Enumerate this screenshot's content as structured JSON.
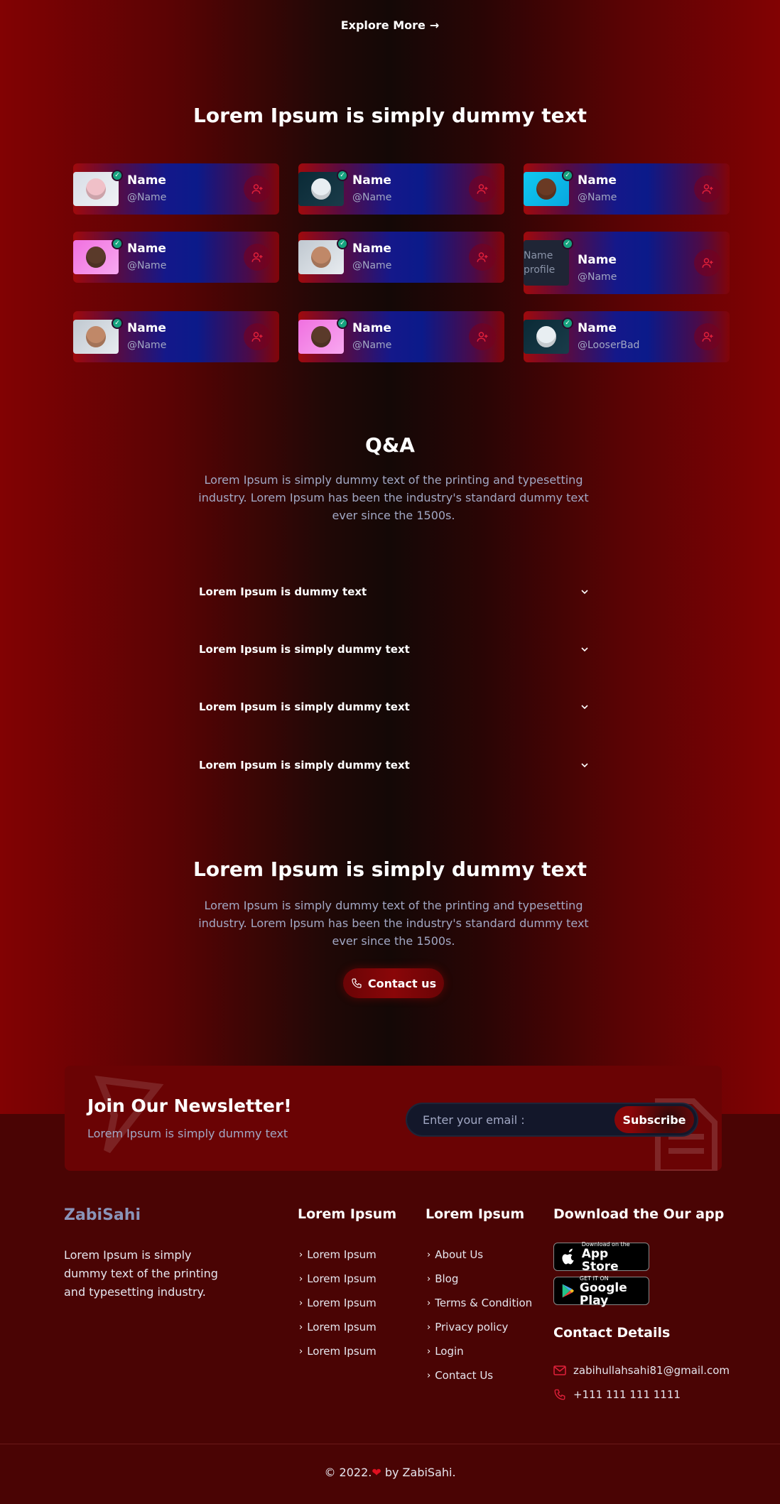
{
  "explore": {
    "label": "Explore More"
  },
  "creators": {
    "title": "Lorem Ipsum is simply dummy text",
    "cards": [
      {
        "name": "Name",
        "handle": "@Name"
      },
      {
        "name": "Name",
        "handle": "@Name"
      },
      {
        "name": "Name",
        "handle": "@Name"
      },
      {
        "name": "Name",
        "handle": "@Name"
      },
      {
        "name": "Name",
        "handle": "@Name"
      },
      {
        "name": "Name",
        "handle": "@Name",
        "broken_image_alt": "Name profile"
      },
      {
        "name": "Name",
        "handle": "@Name"
      },
      {
        "name": "Name",
        "handle": "@Name"
      },
      {
        "name": "Name",
        "handle": "@LooserBad"
      }
    ]
  },
  "qa": {
    "title": "Q&A",
    "description": "Lorem Ipsum is simply dummy text of the printing and typesetting industry. Lorem Ipsum has been the industry's standard dummy text ever since the 1500s.",
    "items": [
      {
        "question": "Lorem Ipsum is dummy text"
      },
      {
        "question": "Lorem Ipsum is simply dummy text"
      },
      {
        "question": "Lorem Ipsum is simply dummy text"
      },
      {
        "question": "Lorem Ipsum is simply dummy text"
      }
    ]
  },
  "cta": {
    "title": "Lorem Ipsum is simply dummy text",
    "description": "Lorem Ipsum is simply dummy text of the printing and typesetting industry. Lorem Ipsum has been the industry's standard dummy text ever since the 1500s.",
    "button_label": "Contact us"
  },
  "newsletter": {
    "title": "Join Our Newsletter!",
    "subtitle": "Lorem Ipsum is simply dummy text",
    "email_placeholder": "Enter your email :",
    "button_label": "Subscribe"
  },
  "footer": {
    "brand": "ZabiSahi",
    "about": "Lorem Ipsum is simply dummy text of the printing and typesetting industry.",
    "col1": {
      "title": "Lorem Ipsum",
      "links": [
        "Lorem Ipsum",
        "Lorem Ipsum",
        "Lorem Ipsum",
        "Lorem Ipsum",
        "Lorem Ipsum"
      ]
    },
    "col2": {
      "title": "Lorem Ipsum",
      "links": [
        "About Us",
        "Blog",
        "Terms & Condition",
        "Privacy policy",
        "Login",
        "Contact Us"
      ]
    },
    "app": {
      "title": "Download the Our app",
      "appstore_small": "Download on the",
      "appstore_big": "App Store",
      "googleplay_small": "GET IT ON",
      "googleplay_big": "Google Play"
    },
    "contact": {
      "title": "Contact Details",
      "email": "zabihullahsahi81@gmail.com",
      "phone": "+111 111 111 1111"
    },
    "copyright_prefix": "© 2022.",
    "copyright_suffix": " by ZabiSahi."
  },
  "colors": {
    "accent": "#8a0608",
    "verify_badge": "#16a37f",
    "follow_icon": "#e0203a",
    "muted_text": "#a2a8c4"
  }
}
